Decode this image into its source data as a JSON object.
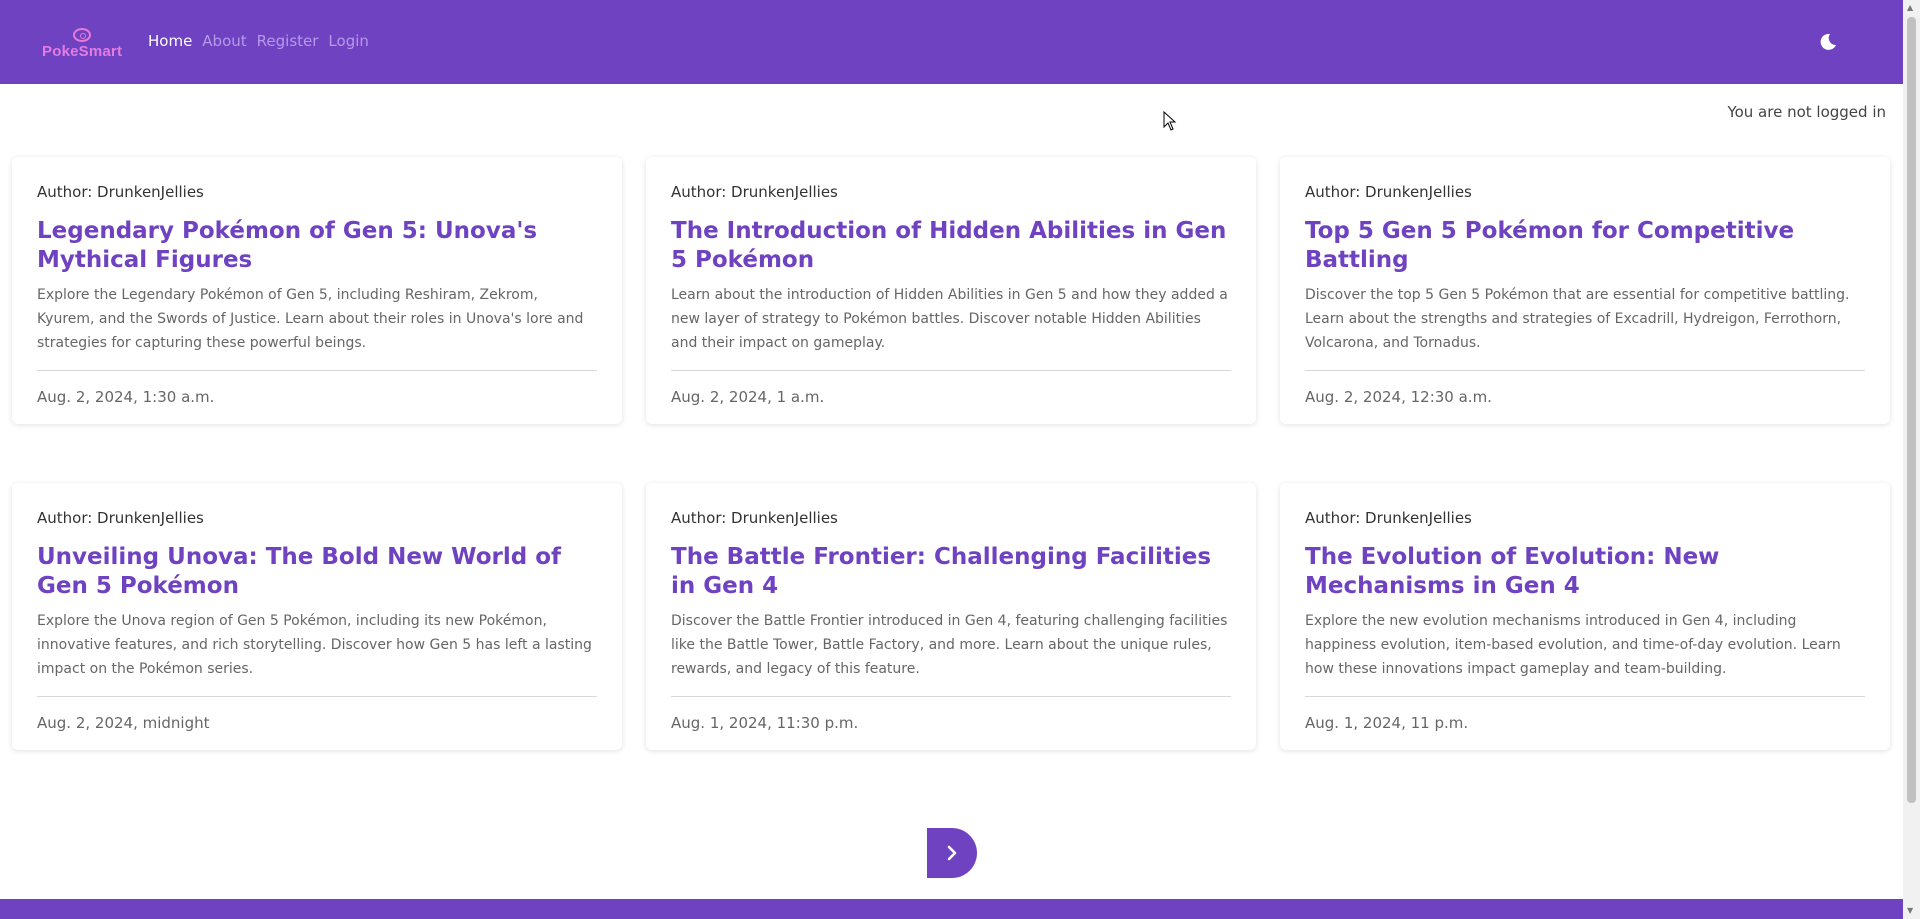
{
  "navbar": {
    "brand": "PokeSmart",
    "links": [
      "Home",
      "About",
      "Register",
      "Login"
    ],
    "active_link": "Home",
    "theme_icon": "moon-icon"
  },
  "auth": {
    "status": "You are not logged in"
  },
  "posts": [
    {
      "author": "Author: DrunkenJellies",
      "title": "Legendary Pokémon of Gen 5: Unova's Mythical Figures",
      "description": "Explore the Legendary Pokémon of Gen 5, including Reshiram, Zekrom, Kyurem, and the Swords of Justice. Learn about their roles in Unova's lore and strategies for capturing these powerful beings.",
      "date": "Aug. 2, 2024, 1:30 a.m."
    },
    {
      "author": "Author: DrunkenJellies",
      "title": "The Introduction of Hidden Abilities in Gen 5 Pokémon",
      "description": "Learn about the introduction of Hidden Abilities in Gen 5 and how they added a new layer of strategy to Pokémon battles. Discover notable Hidden Abilities and their impact on gameplay.",
      "date": "Aug. 2, 2024, 1 a.m."
    },
    {
      "author": "Author: DrunkenJellies",
      "title": "Top 5 Gen 5 Pokémon for Competitive Battling",
      "description": "Discover the top 5 Gen 5 Pokémon that are essential for competitive battling. Learn about the strengths and strategies of Excadrill, Hydreigon, Ferrothorn, Volcarona, and Tornadus.",
      "date": "Aug. 2, 2024, 12:30 a.m."
    },
    {
      "author": "Author: DrunkenJellies",
      "title": "Unveiling Unova: The Bold New World of Gen 5 Pokémon",
      "description": "Explore the Unova region of Gen 5 Pokémon, including its new Pokémon, innovative features, and rich storytelling. Discover how Gen 5 has left a lasting impact on the Pokémon series.",
      "date": "Aug. 2, 2024, midnight"
    },
    {
      "author": "Author: DrunkenJellies",
      "title": "The Battle Frontier: Challenging Facilities in Gen 4",
      "description": "Discover the Battle Frontier introduced in Gen 4, featuring challenging facilities like the Battle Tower, Battle Factory, and more. Learn about the unique rules, rewards, and legacy of this feature.",
      "date": "Aug. 1, 2024, 11:30 p.m."
    },
    {
      "author": "Author: DrunkenJellies",
      "title": "The Evolution of Evolution: New Mechanisms in Gen 4",
      "description": "Explore the new evolution mechanisms introduced in Gen 4, including happiness evolution, item-based evolution, and time-of-day evolution. Learn how these innovations impact gameplay and team-building.",
      "date": "Aug. 1, 2024, 11 p.m."
    }
  ],
  "pagination": {
    "next_icon": "chevron-right-icon"
  },
  "colors": {
    "primary": "#6f42c1",
    "brand": "#e47ce0"
  }
}
